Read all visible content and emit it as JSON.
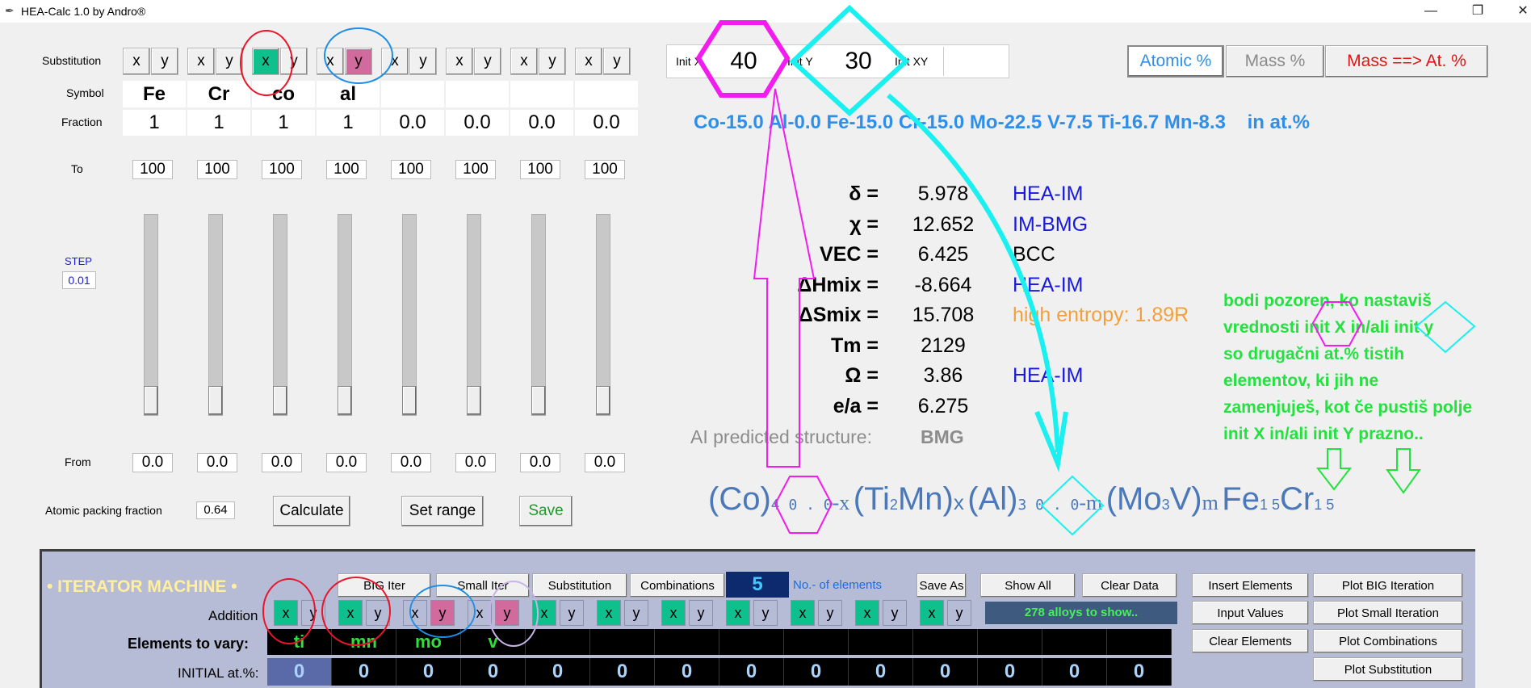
{
  "window": {
    "title": "HEA-Calc 1.0 by Andro®",
    "minimize": "—",
    "maximize": "❐",
    "close": "✕"
  },
  "left": {
    "substitution_label": "Substitution",
    "symbol_label": "Symbol",
    "fraction_label": "Fraction",
    "to_label": "To",
    "step_label": "STEP",
    "step_value": "0.01",
    "from_label": "From",
    "apf_label": "Atomic packing fraction",
    "apf_value": "0.64",
    "calculate": "Calculate",
    "set_range": "Set range",
    "save": "Save",
    "xy_labels": [
      "x",
      "y"
    ],
    "columns": [
      {
        "symbol": "Fe",
        "fraction": "1",
        "to": "100",
        "from": "0.0",
        "x": "normal",
        "y": "normal"
      },
      {
        "symbol": "Cr",
        "fraction": "1",
        "to": "100",
        "from": "0.0",
        "x": "normal",
        "y": "normal"
      },
      {
        "symbol": "co",
        "fraction": "1",
        "to": "100",
        "from": "0.0",
        "x": "green",
        "y": "normal"
      },
      {
        "symbol": "al",
        "fraction": "1",
        "to": "100",
        "from": "0.0",
        "x": "normal",
        "y": "pink"
      },
      {
        "symbol": "",
        "fraction": "0.0",
        "to": "100",
        "from": "0.0",
        "x": "normal",
        "y": "normal"
      },
      {
        "symbol": "",
        "fraction": "0.0",
        "to": "100",
        "from": "0.0",
        "x": "normal",
        "y": "normal"
      },
      {
        "symbol": "",
        "fraction": "0.0",
        "to": "100",
        "from": "0.0",
        "x": "normal",
        "y": "normal"
      },
      {
        "symbol": "",
        "fraction": "0.0",
        "to": "100",
        "from": "0.0",
        "x": "normal",
        "y": "normal"
      }
    ]
  },
  "init": {
    "init_x_label": "Init X",
    "init_x_value": "40",
    "init_y_label": "Init Y",
    "init_y_value": "30",
    "init_xy_label": "Init XY",
    "init_xy_value": ""
  },
  "mode_buttons": {
    "atomic": "Atomic %",
    "mass": "Mass %",
    "convert": "Mass ==> At. %"
  },
  "composition": {
    "text": "Co-15.0 Al-0.0 Fe-15.0 Cr-15.0 Mo-22.5 V-7.5 Ti-16.7 Mn-8.3",
    "unit": "in at.%"
  },
  "properties": [
    {
      "label": "δ =",
      "value": "5.978",
      "class": "HEA-IM",
      "class_color": "#1a1adc"
    },
    {
      "label": "χ =",
      "value": "12.652",
      "class": "IM-BMG",
      "class_color": "#1a1adc"
    },
    {
      "label": "VEC =",
      "value": "6.425",
      "class": "BCC",
      "class_color": "#000000"
    },
    {
      "label": "ΔHmix =",
      "value": "-8.664",
      "class": "HEA-IM",
      "class_color": "#1a1adc"
    },
    {
      "label": "ΔSmix =",
      "value": "15.708",
      "class": "high entropy: 1.89R",
      "class_color": "#f3a03c"
    },
    {
      "label": "Tm =",
      "value": "2129",
      "class": "",
      "class_color": "#000000"
    },
    {
      "label": "Ω =",
      "value": "3.86",
      "class": "HEA-IM",
      "class_color": "#1a1adc"
    },
    {
      "label": "e/a =",
      "value": "6.275",
      "class": "",
      "class_color": "#000000"
    }
  ],
  "ai": {
    "label": "AI predicted structure:",
    "value": "BMG"
  },
  "formula": {
    "p1": "(Co)",
    "s1": "4 0 . 0",
    "p2": "-x",
    "p3": "(Ti",
    "s2": "2",
    "p4": "Mn)",
    "p5": "x",
    "p6": "(Al)",
    "s3": "3 0 . 0",
    "p7": "-m",
    "p8": "(Mo",
    "s4": "3",
    "p9": "V)",
    "p10": "m",
    "p11": "Fe",
    "s5": "1 5",
    "p12": "Cr",
    "s6": "1 5"
  },
  "annotation_note": "bodi pozoren, ko nastaviš vrednosti init X in/ali init y so drugačni at.% tistih elementov, ki jih ne zamenjuješ, kot če pustiš polje init X in/ali init Y prazno..",
  "note_lines": [
    "bodi pozoren, ko nastaviš",
    "vrednosti init X in/ali init y",
    "so drugačni at.% tistih",
    "elementov, ki jih ne",
    "zamenjuješ, kot če pustiš polje",
    "init X in/ali init Y prazno.."
  ],
  "iterator": {
    "title": "• ITERATOR MACHINE •",
    "big_iter": "BIG Iter",
    "small_iter": "Small Iter",
    "substitution": "Substitution",
    "combinations": "Combinations",
    "n_elements": "5",
    "n_elements_label": "No.- of elements",
    "save_as": "Save As",
    "show_all": "Show All",
    "clear_data": "Clear Data",
    "insert_elements": "Insert Elements",
    "input_values": "Input Values",
    "clear_elements": "Clear Elements",
    "plot_big": "Plot BIG Iteration",
    "plot_small": "Plot Small Iteration",
    "plot_comb": "Plot Combinations",
    "plot_sub": "Plot Substitution",
    "addition_label": "Addition",
    "alloys_status": "278 alloys to show..",
    "vary_label": "Elements to vary:",
    "initial_label": "INITIAL at.%:",
    "addition": [
      {
        "x": "green",
        "y": "normal"
      },
      {
        "x": "green",
        "y": "normal"
      },
      {
        "x": "normal",
        "y": "pink"
      },
      {
        "x": "normal",
        "y": "pink"
      },
      {
        "x": "green",
        "y": "normal"
      },
      {
        "x": "green",
        "y": "normal"
      },
      {
        "x": "green",
        "y": "normal"
      },
      {
        "x": "green",
        "y": "normal"
      },
      {
        "x": "green",
        "y": "normal"
      },
      {
        "x": "green",
        "y": "normal"
      },
      {
        "x": "green",
        "y": "normal"
      }
    ],
    "vary": [
      "ti",
      "mn",
      "mo",
      "v",
      "",
      "",
      "",
      "",
      "",
      "",
      "",
      "",
      "",
      ""
    ],
    "initial": [
      "0",
      "0",
      "0",
      "0",
      "0",
      "0",
      "0",
      "0",
      "0",
      "0",
      "0",
      "0",
      "0",
      "0"
    ]
  },
  "colors": {
    "green": "#0fbf8c",
    "pink": "#d16b9e",
    "composition_blue": "#2f8fe8",
    "formula_blue": "#4a78b8",
    "annotation_magenta": "#f21cef",
    "annotation_cyan": "#19f0ef",
    "annotation_green": "#23e23f",
    "iterator_bg": "#b7bcd6"
  }
}
